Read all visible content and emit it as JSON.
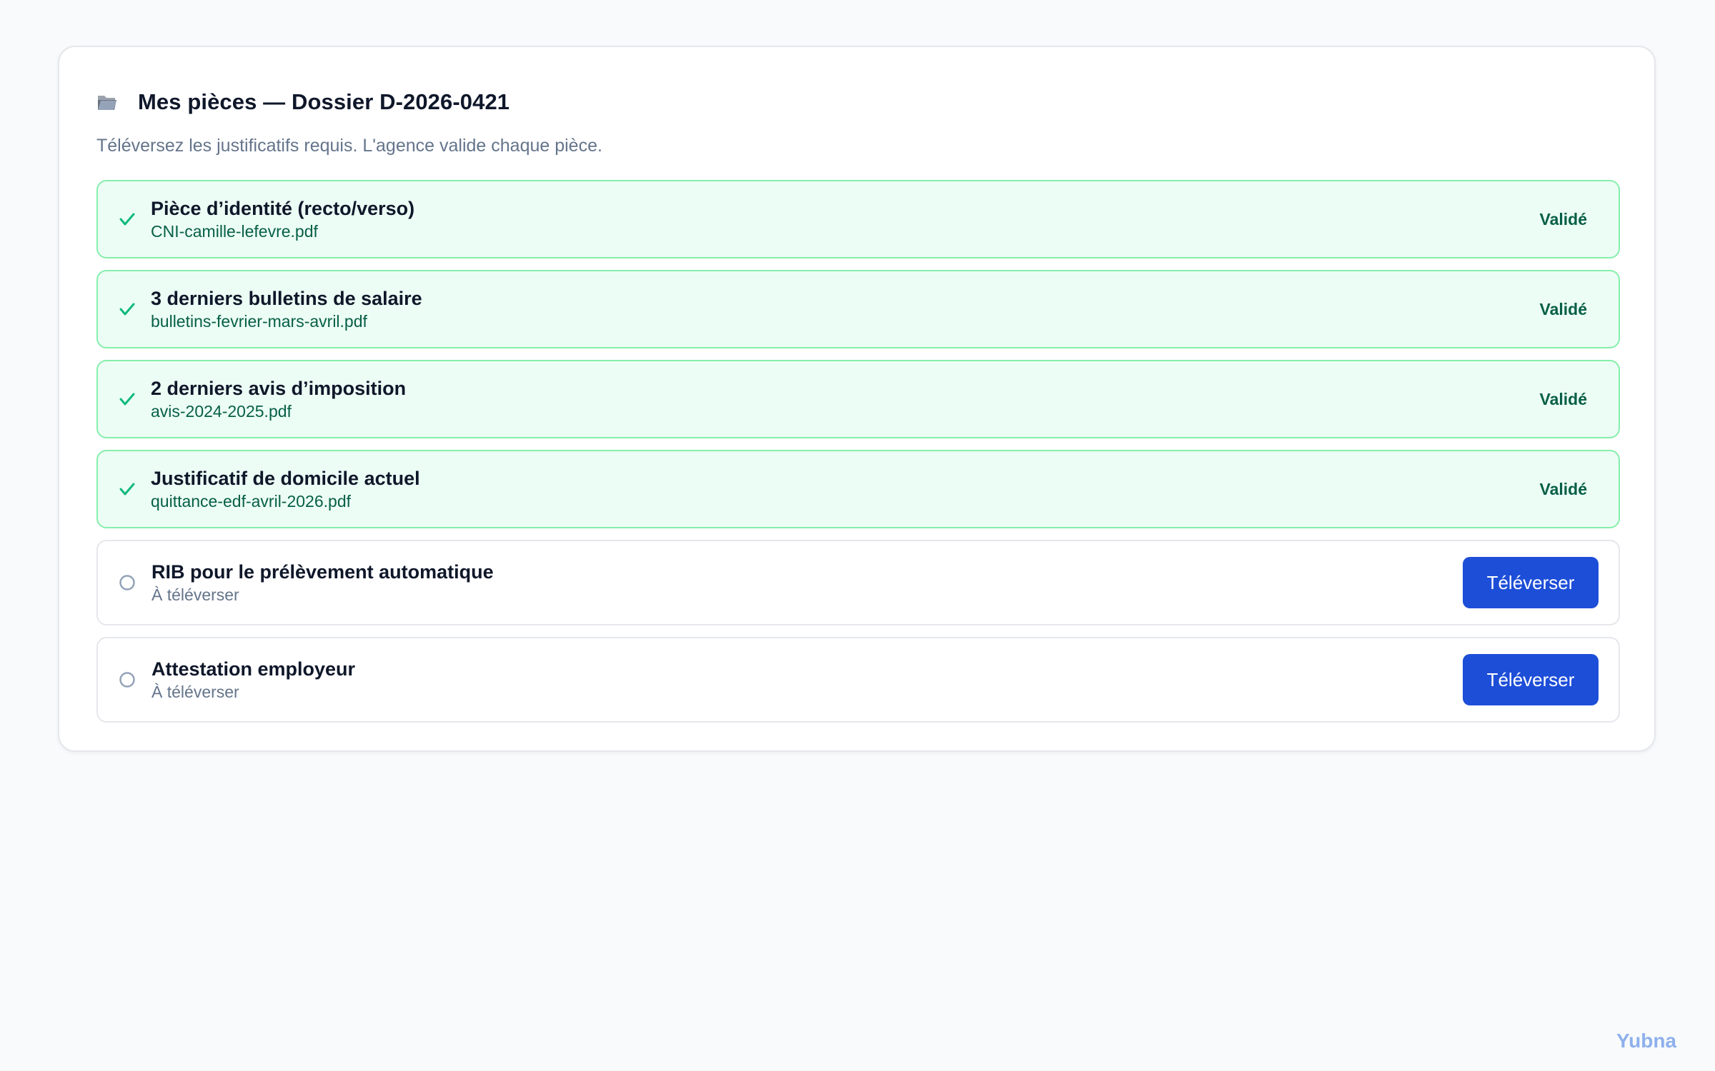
{
  "card": {
    "title": "Mes pièces — Dossier D-2026-0421",
    "folder_icon": "open-folder-icon",
    "subtitle": "Téléversez les justificatifs requis. L'agence valide chaque pièce."
  },
  "documents": [
    {
      "title": "Pièce d’identité (recto/verso)",
      "file": "CNI-camille-lefevre.pdf",
      "status": "Validé",
      "state": "validated",
      "icon": "check-icon"
    },
    {
      "title": "3 derniers bulletins de salaire",
      "file": "bulletins-fevrier-mars-avril.pdf",
      "status": "Validé",
      "state": "validated",
      "icon": "check-icon"
    },
    {
      "title": "2 derniers avis d’imposition",
      "file": "avis-2024-2025.pdf",
      "status": "Validé",
      "state": "validated",
      "icon": "check-icon"
    },
    {
      "title": "Justificatif de domicile actuel",
      "file": "quittance-edf-avril-2026.pdf",
      "status": "Validé",
      "state": "validated",
      "icon": "check-icon"
    },
    {
      "title": "RIB pour le prélèvement automatique",
      "file": "À téléverser",
      "action": "Téléverser",
      "state": "pending",
      "icon": "empty-circle-icon"
    },
    {
      "title": "Attestation employeur",
      "file": "À téléverser",
      "action": "Téléverser",
      "state": "pending",
      "icon": "empty-circle-icon"
    }
  ],
  "brand": "Yubna",
  "colors": {
    "accent": "#1d4ed8",
    "validated_bg": "#ecfdf5",
    "validated_border": "#86efac",
    "validated_text": "#065f46",
    "check": "#10b981",
    "muted": "#64748b"
  }
}
